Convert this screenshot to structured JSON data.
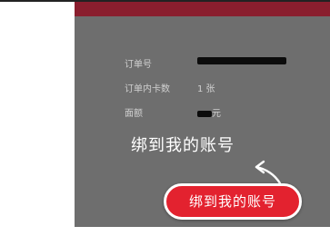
{
  "order": {
    "order_no_label": "订单号",
    "card_count_label": "订单内卡数",
    "card_count_value": "1 张",
    "face_value_label": "面额",
    "face_value_unit": "元"
  },
  "overlay": {
    "hint_text": "绑到我的账号"
  },
  "action": {
    "bind_button_label": "绑到我的账号"
  },
  "colors": {
    "top_band": "#8a1e2e",
    "panel": "#6e6e6e",
    "button": "#e3222f"
  }
}
